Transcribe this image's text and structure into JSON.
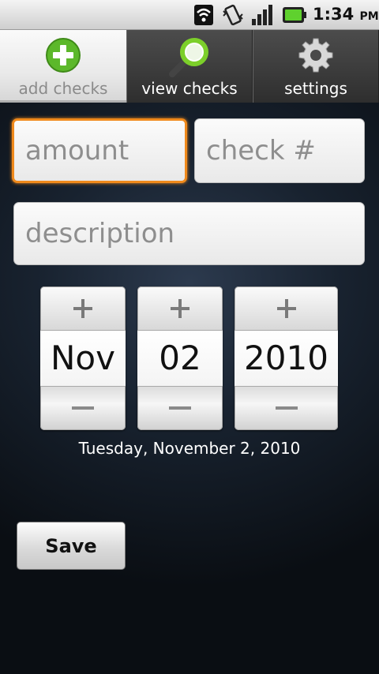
{
  "status_bar": {
    "time": "1:34",
    "ampm": "PM"
  },
  "tabs": [
    {
      "label": "add checks",
      "icon": "add-icon",
      "active": true
    },
    {
      "label": "view checks",
      "icon": "magnifier-icon",
      "active": false
    },
    {
      "label": "settings",
      "icon": "gear-icon",
      "active": false
    }
  ],
  "form": {
    "amount_placeholder": "amount",
    "check_placeholder": "check #",
    "description_placeholder": "description"
  },
  "date_picker": {
    "month": "Nov",
    "day": "02",
    "year": "2010",
    "caption": "Tuesday, November 2, 2010"
  },
  "actions": {
    "save_label": "Save"
  },
  "colors": {
    "focus_border": "#f08a1c",
    "add_icon_green": "#5cb82a",
    "magnifier_green": "#7ccf2a"
  }
}
